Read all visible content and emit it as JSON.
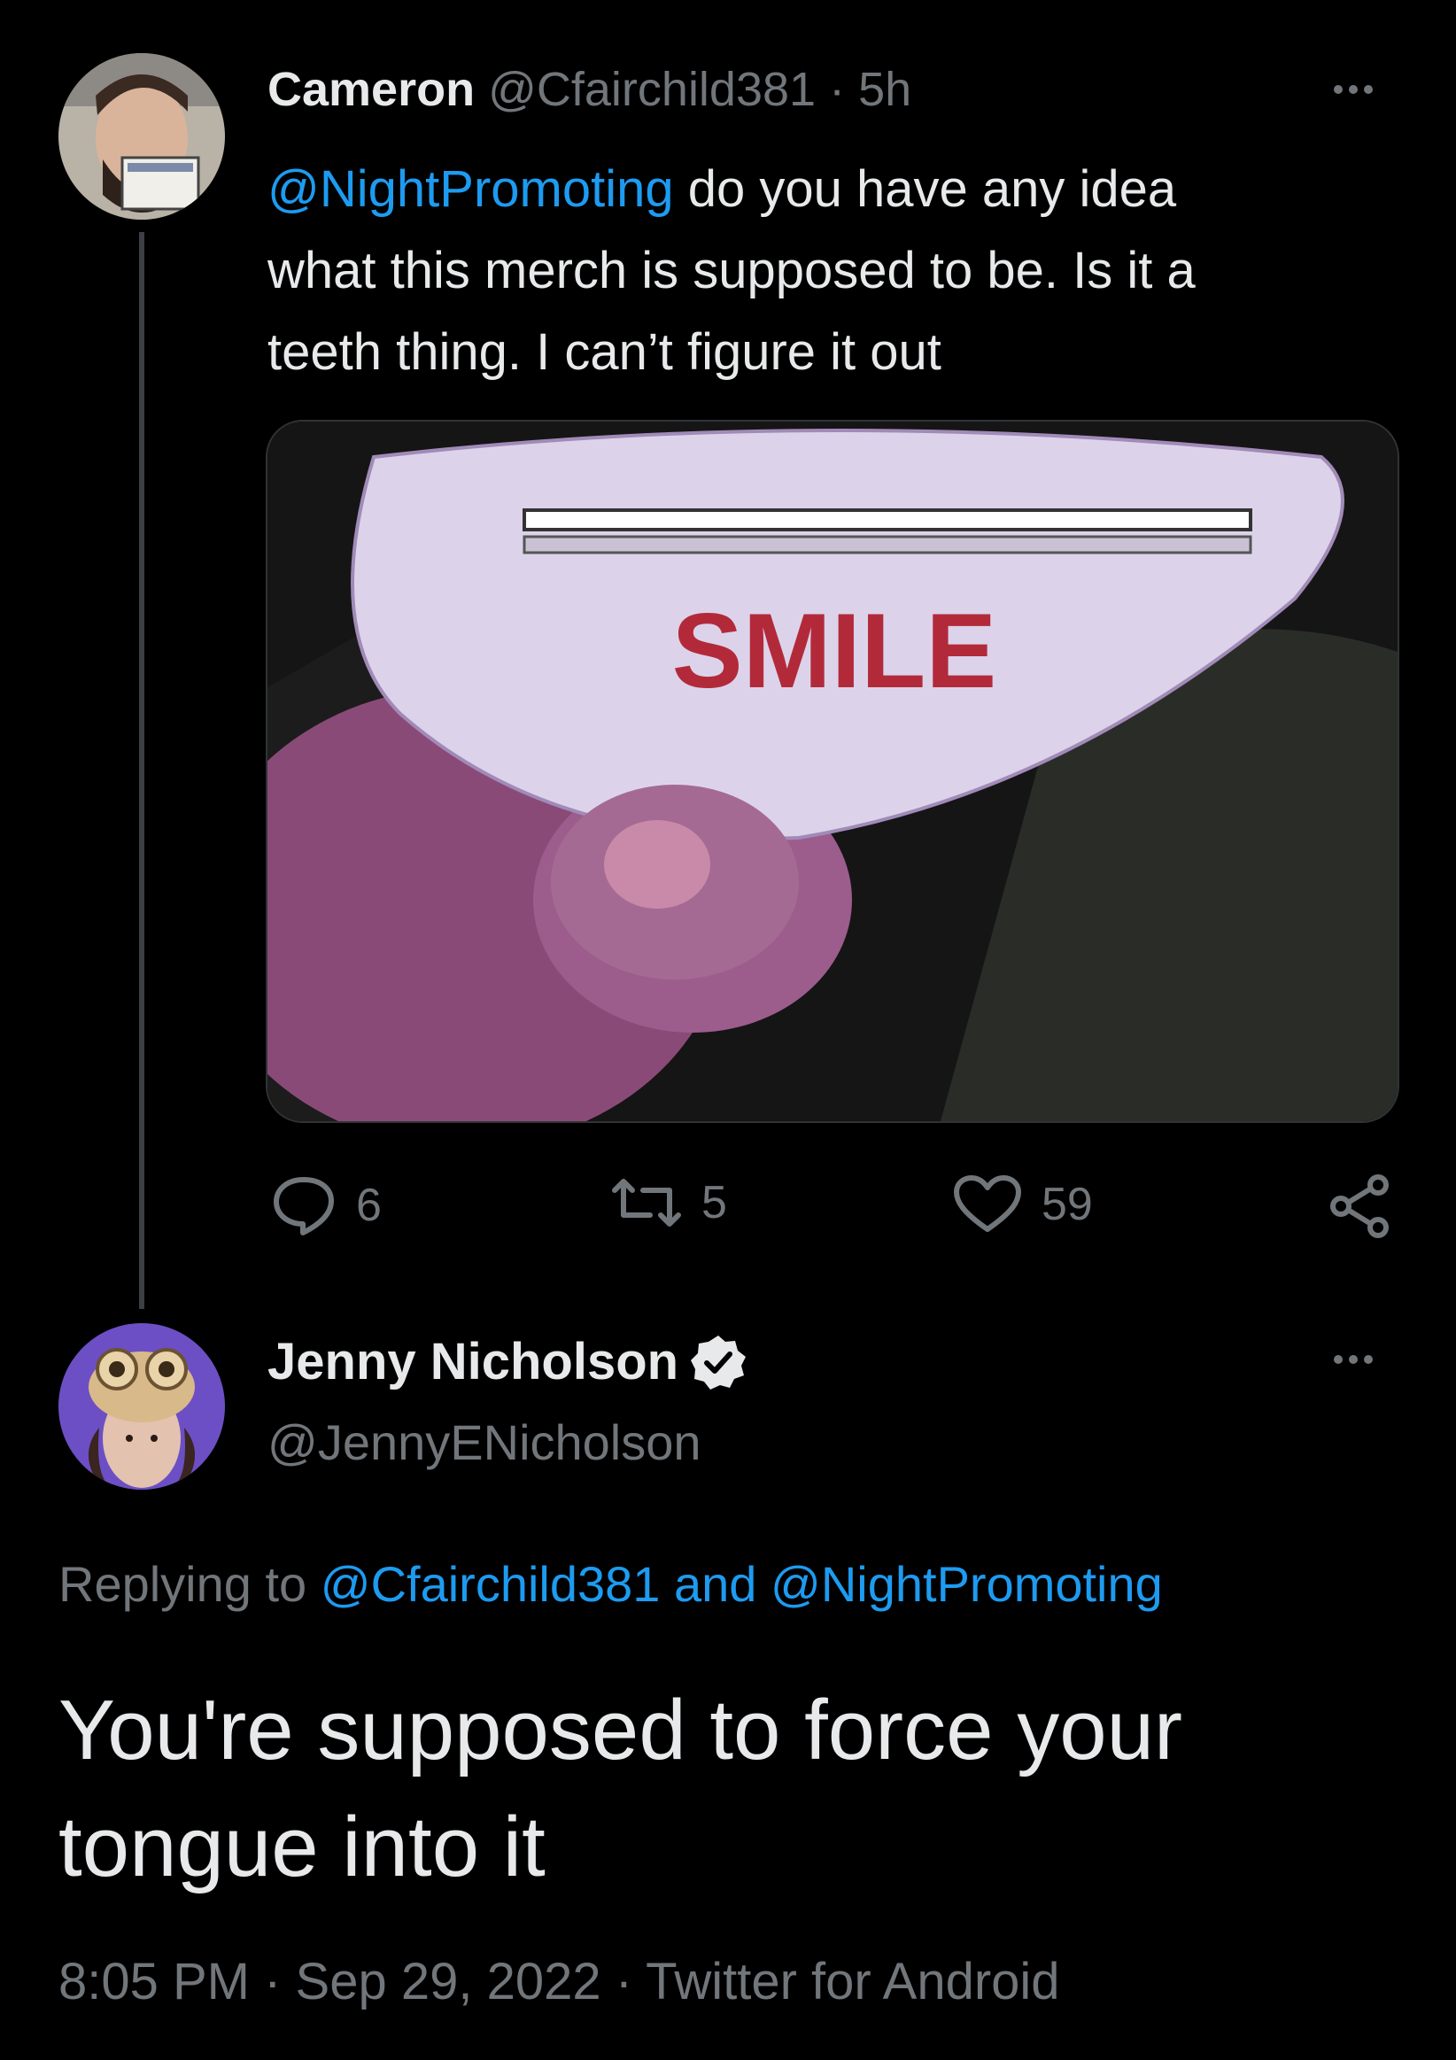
{
  "tweet": {
    "author_name": "Cameron",
    "handle": "@Cfairchild381",
    "time": "5h",
    "separator": "·",
    "mention": "@NightPromoting",
    "text_line1": "do you have any idea",
    "text_line2": "what this merch is supposed to be. Is it  a",
    "text_line3": "teeth thing. I can’t figure it out",
    "media_text": "SMILE",
    "replies": "6",
    "retweets": "5",
    "likes": "59"
  },
  "reply": {
    "author_name": "Jenny Nicholson",
    "handle": "@JennyENicholson",
    "replying_prefix": "Replying to",
    "replying_user1": "@Cfairchild381",
    "replying_and": "and",
    "replying_user2": "@NightPromoting",
    "text_line1": "You're supposed to force your",
    "text_line2": "tongue into it",
    "timestamp": "8:05 PM · Sep 29, 2022 · Twitter for Android"
  },
  "colors": {
    "background": "#000000",
    "link": "#1d9bf0",
    "muted": "#71767b",
    "text": "#e7e9ea"
  },
  "icons": [
    "more-icon",
    "reply-icon",
    "retweet-icon",
    "like-icon",
    "share-icon",
    "verified-icon"
  ]
}
